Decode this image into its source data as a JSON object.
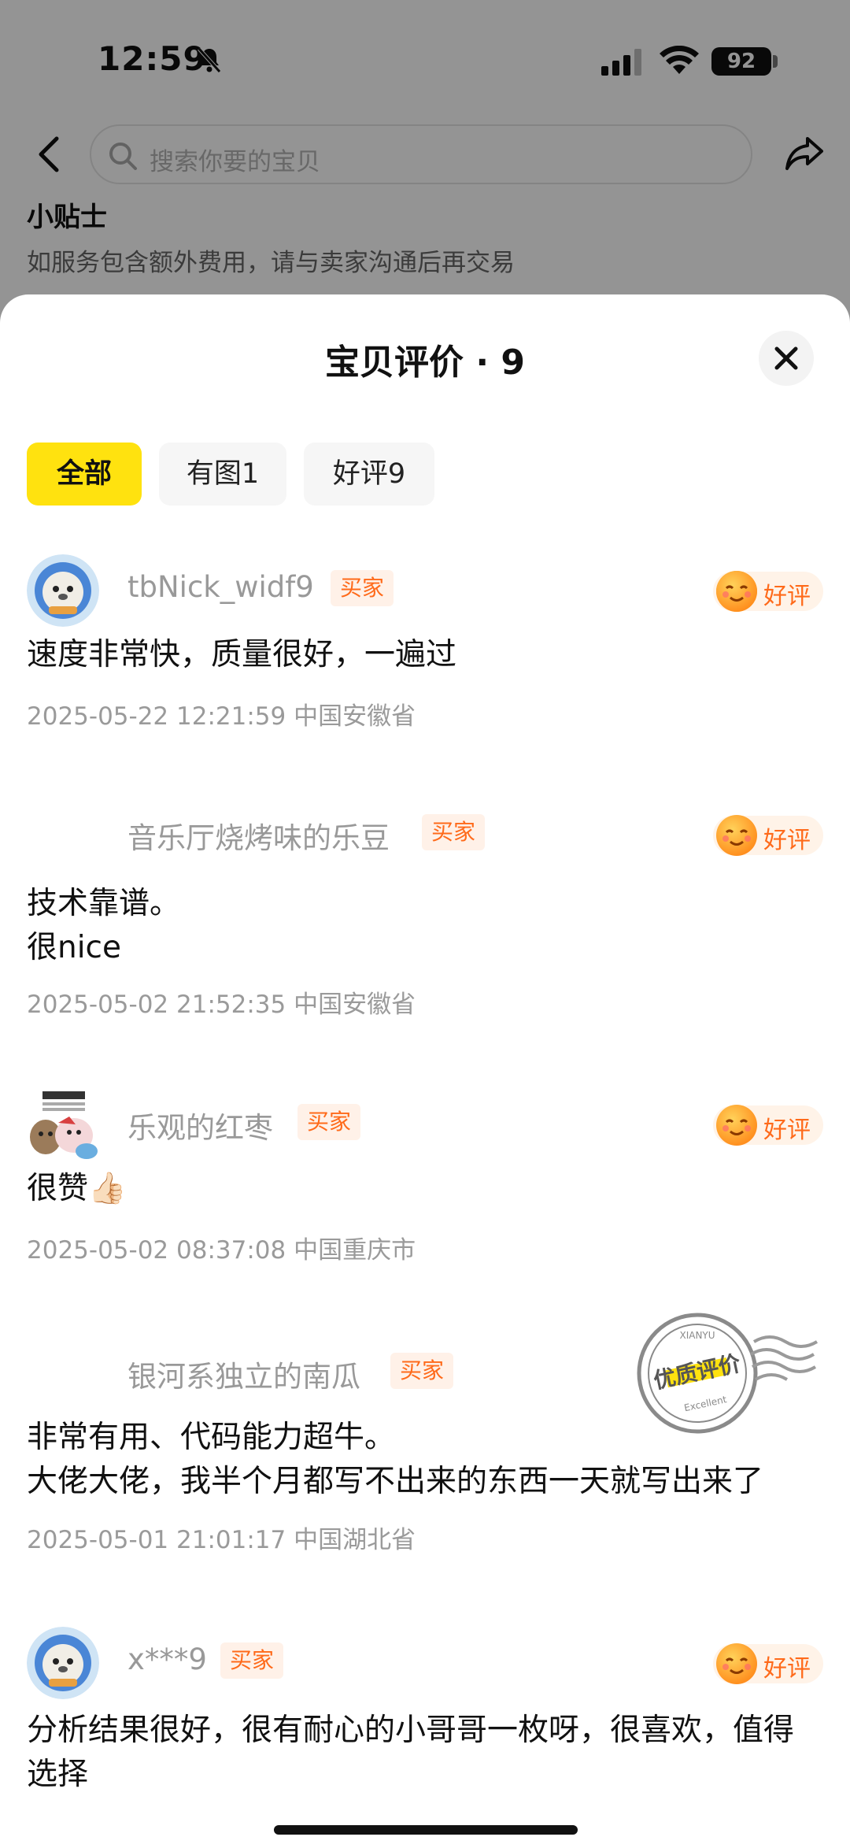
{
  "status_bar": {
    "time": "12:59",
    "battery": "92"
  },
  "header": {
    "search_placeholder": "搜索你要的宝贝"
  },
  "tips": {
    "title": "小贴士",
    "text": "如服务包含额外费用，请与卖家沟通后再交易"
  },
  "sheet": {
    "title": "宝贝评价 · 9",
    "filters": [
      {
        "label": "全部",
        "active": true
      },
      {
        "label": "有图1",
        "active": false
      },
      {
        "label": "好评9",
        "active": false
      }
    ]
  },
  "reviews": [
    {
      "username": "tbNick_widf9",
      "tag": "买家",
      "rating": "好评",
      "text": "速度非常快，质量很好，一遍过",
      "meta": "2025-05-22 12:21:59 中国安徽省"
    },
    {
      "username": "音乐厅烧烤味的乐豆",
      "tag": "买家",
      "rating": "好评",
      "text": "技术靠谱。\n很nice",
      "meta": "2025-05-02 21:52:35 中国安徽省"
    },
    {
      "username": "乐观的红枣",
      "tag": "买家",
      "rating": "好评",
      "text": "很赞👍🏻",
      "meta": "2025-05-02 08:37:08 中国重庆市"
    },
    {
      "username": "银河系独立的南瓜",
      "tag": "买家",
      "rating": "",
      "text": "非常有用、代码能力超牛。\n大佬大佬，我半个月都写不出来的东西一天就写出来了",
      "meta": "2025-05-01 21:01:17 中国湖北省"
    },
    {
      "username": "x***9",
      "tag": "买家",
      "rating": "好评",
      "text": "分析结果很好，很有耐心的小哥哥一枚呀，很喜欢，值得选择",
      "meta": ""
    }
  ],
  "stamp": {
    "top": "XIANYU",
    "main": "优质评价",
    "bottom": "Excellent"
  },
  "colors": {
    "accent_yellow": "#ffe20f",
    "tag_orange": "#ff6a1a",
    "tag_bg": "#fff1e8"
  }
}
